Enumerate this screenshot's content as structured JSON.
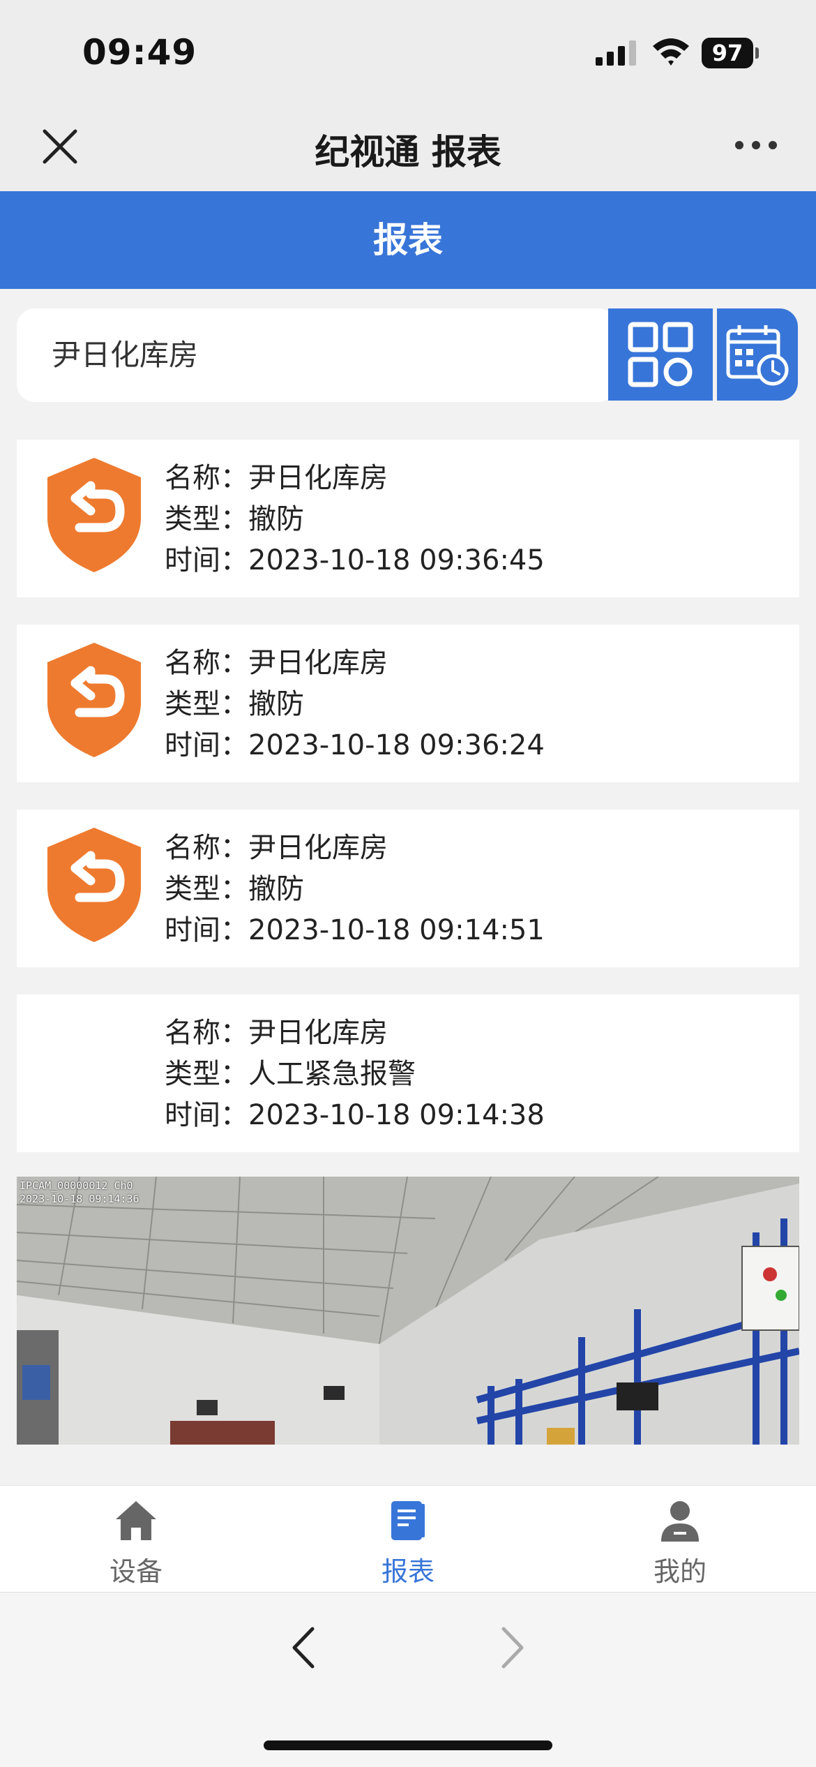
{
  "status_bar": {
    "time": "09:49",
    "battery": "97"
  },
  "nav": {
    "title": "纪视通 报表"
  },
  "header": {
    "title": "报表"
  },
  "search": {
    "value": "尹日化库房"
  },
  "labels": {
    "name": "名称：",
    "type": "类型：",
    "time": "时间："
  },
  "records": [
    {
      "name": "尹日化库房",
      "type": "撤防",
      "time": "2023-10-18 09:36:45",
      "icon": "disarm-shield-icon"
    },
    {
      "name": "尹日化库房",
      "type": "撤防",
      "time": "2023-10-18 09:36:24",
      "icon": "disarm-shield-icon"
    },
    {
      "name": "尹日化库房",
      "type": "撤防",
      "time": "2023-10-18 09:14:51",
      "icon": "disarm-shield-icon"
    },
    {
      "name": "尹日化库房",
      "type": "人工紧急报警",
      "time": "2023-10-18 09:14:38",
      "icon": ""
    }
  ],
  "snapshot": {
    "caption": "IPCAM_00000012 Ch0\n2023-10-18 09:14:36"
  },
  "tabs": [
    {
      "label": "设备",
      "icon": "home-icon",
      "active": false
    },
    {
      "label": "报表",
      "icon": "report-icon",
      "active": true
    },
    {
      "label": "我的",
      "icon": "user-icon",
      "active": false
    }
  ],
  "colors": {
    "primary": "#3875d8",
    "alarm_orange": "#ee7a2f"
  }
}
